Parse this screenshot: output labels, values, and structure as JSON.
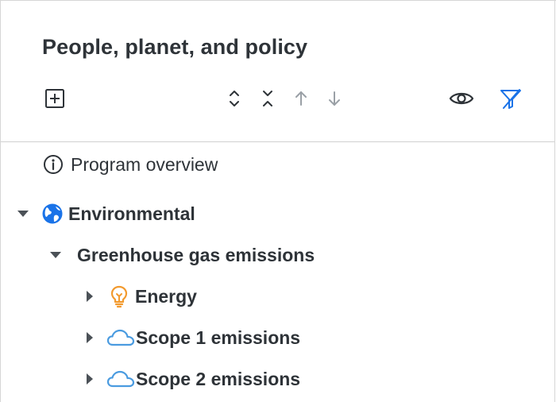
{
  "header": {
    "title": "People, planet, and policy",
    "toolbar": {
      "add_icon": "plus-square-icon",
      "expand_icon": "expand-all-icon",
      "collapse_icon": "collapse-all-icon",
      "move_up_icon": "arrow-up-icon",
      "move_down_icon": "arrow-down-icon",
      "view_icon": "eye-icon",
      "filter_icon": "filter-icon"
    }
  },
  "tree": {
    "overview": {
      "label": "Program overview",
      "icon": "info-circle-icon"
    },
    "environmental": {
      "label": "Environmental",
      "icon": "globe-icon",
      "expanded": true,
      "children": {
        "ghg": {
          "label": "Greenhouse gas emissions",
          "expanded": true,
          "items": [
            {
              "label": "Energy",
              "icon": "lightbulb-icon",
              "expanded": false
            },
            {
              "label": "Scope 1 emissions",
              "icon": "cloud-icon",
              "expanded": false
            },
            {
              "label": "Scope 2 emissions",
              "icon": "cloud-icon",
              "expanded": false
            }
          ]
        }
      }
    }
  },
  "colors": {
    "text": "#2e3338",
    "accent_blue": "#1a73e8",
    "cloud_blue": "#4a9be0",
    "bulb_orange": "#f29a2e",
    "muted": "#9aa0a6",
    "border": "#d0d0d0"
  }
}
